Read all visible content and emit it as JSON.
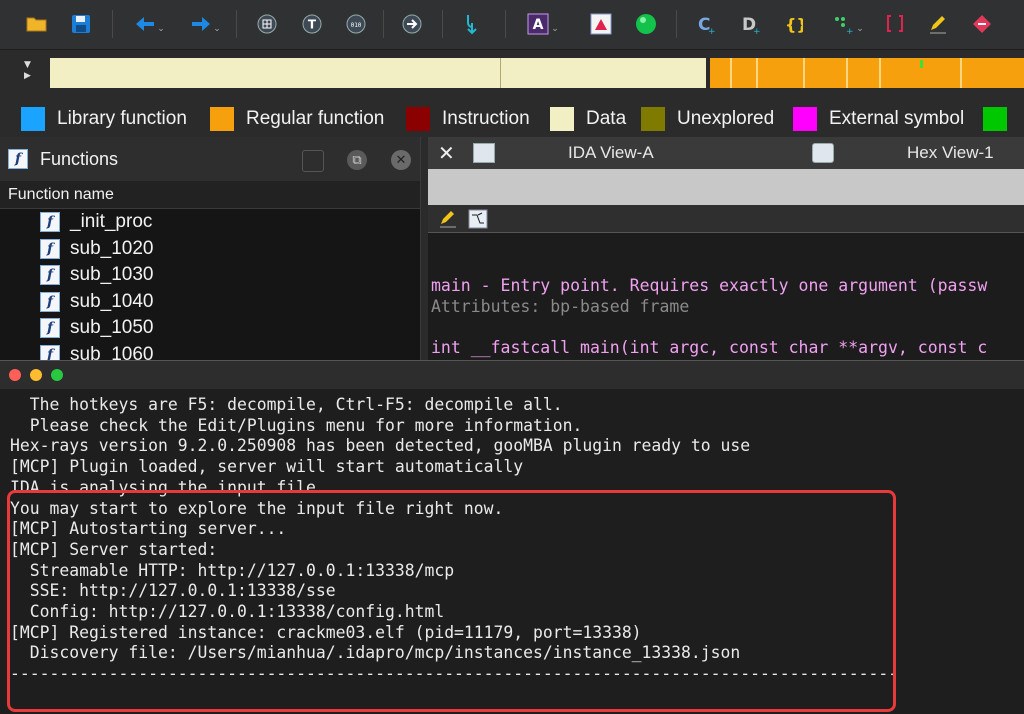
{
  "toolbar": {
    "buttons": [
      {
        "icon": "open-folder-icon"
      },
      {
        "icon": "save-disk-icon"
      },
      {
        "icon": "back-arrow-icon",
        "has_dropdown": true
      },
      {
        "icon": "forward-arrow-icon",
        "has_dropdown": true
      },
      {
        "icon": "grid-icon"
      },
      {
        "icon": "text-icon"
      },
      {
        "icon": "binary-icon"
      },
      {
        "icon": "jump-icon"
      },
      {
        "icon": "step-down-icon"
      },
      {
        "icon": "ascii-string-icon",
        "has_dropdown": true
      },
      {
        "icon": "flag-icon"
      },
      {
        "icon": "run-green-icon"
      },
      {
        "icon": "make-code-icon"
      },
      {
        "icon": "make-data-icon"
      },
      {
        "icon": "make-struct-icon"
      },
      {
        "icon": "array-icon",
        "has_dropdown": true
      },
      {
        "icon": "bracket-icon"
      },
      {
        "icon": "edit-pencil-icon"
      },
      {
        "icon": "stop-breakpoint-icon"
      }
    ]
  },
  "legend": {
    "items": [
      {
        "label": "Library function",
        "color": "#1aa3ff"
      },
      {
        "label": "Regular function",
        "color": "#f5a00c"
      },
      {
        "label": "Instruction",
        "color": "#8b0000"
      },
      {
        "label": "Data",
        "color": "#f2efc4"
      },
      {
        "label": "Unexplored",
        "color": "#7f7a00"
      },
      {
        "label": "External symbol",
        "color": "#ff00ff"
      },
      {
        "label": "",
        "color": "#00c800"
      }
    ]
  },
  "functions_panel": {
    "title": "Functions",
    "column_header": "Function name",
    "functions": [
      "_init_proc",
      "sub_1020",
      "sub_1030",
      "sub_1040",
      "sub_1050",
      "sub_1060"
    ]
  },
  "ida_view": {
    "tabs": [
      {
        "label": "IDA View-A"
      },
      {
        "label": "Hex View-1"
      }
    ],
    "code_lines": [
      {
        "text": "main - Entry point. Requires exactly one argument (passw",
        "color": "#f0a0f0"
      },
      {
        "text": "Attributes: bp-based frame",
        "color": "#8a8a8a"
      },
      {
        "text": "int __fastcall main(int argc, const char **argv, const c",
        "color": "#f0a0f0"
      }
    ]
  },
  "output_window": {
    "traffic_lights": [
      "#ff5f57",
      "#febc2e",
      "#28c840"
    ],
    "lines": [
      "  The hotkeys are F5: decompile, Ctrl-F5: decompile all.",
      "",
      "  Please check the Edit/Plugins menu for more information.",
      "Hex-rays version 9.2.0.250908 has been detected, gooMBA plugin ready to use",
      "[MCP] Plugin loaded, server will start automatically",
      "IDA is analysing the input file...",
      "You may start to explore the input file right now.",
      "[MCP] Autostarting server...",
      "[MCP] Server started:",
      "  Streamable HTTP: http://127.0.0.1:13338/mcp",
      "  SSE: http://127.0.0.1:13338/sse",
      "  Config: http://127.0.0.1:13338/config.html",
      "[MCP] Registered instance: crackme03.elf (pid=11179, port=13338)",
      "  Discovery file: /Users/mianhua/.idapro/mcp/instances/instance_13338.json",
      "------------------------------------------------------------------------------------------"
    ],
    "highlight_color": "#e83a3a"
  }
}
